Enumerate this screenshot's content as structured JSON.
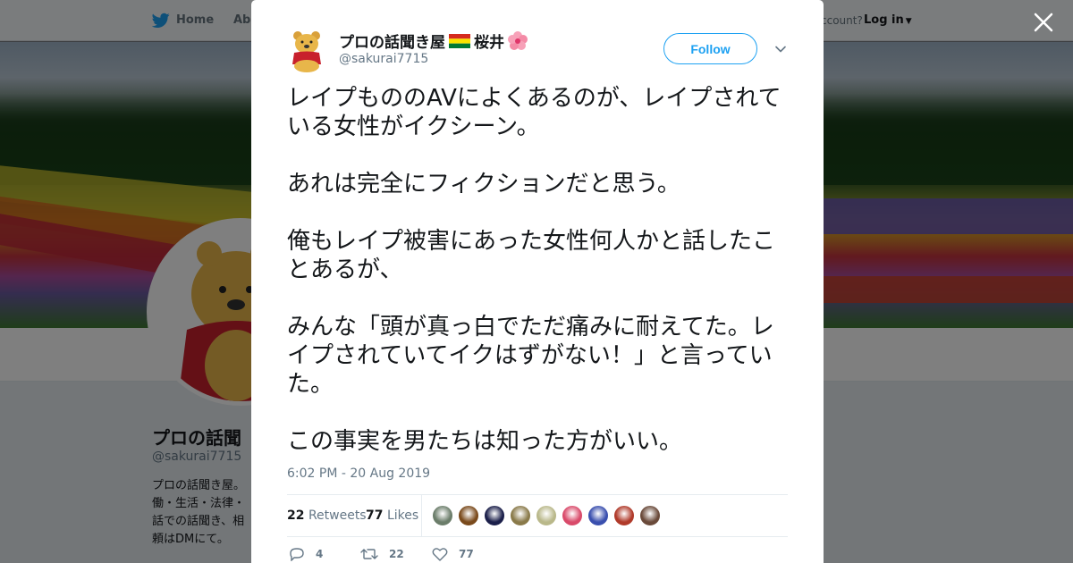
{
  "topnav": {
    "home_label": "Home",
    "about_label": "Abo",
    "account_prompt": "ccount?",
    "login_label": "Log in"
  },
  "profile": {
    "name": "プロの話聞",
    "handle": "@sakurai7715",
    "bio": "プロの話聞き屋。働・生活・法律・話での話聞き、相頼はDMにて。"
  },
  "tweet": {
    "author_name": "プロの話聞き屋",
    "author_suffix": "桜井",
    "author_handle": "@sakurai7715",
    "follow_label": "Follow",
    "paragraphs": [
      "レイプもののAVによくあるのが、レイプされている女性がイクシーン。",
      "あれは完全にフィクションだと思う。",
      "俺もレイプ被害にあった女性何人かと話したことあるが、",
      "みんな「頭が真っ白でただ痛みに耐えてた。レイプされていてイクはずがない！」と言っていた。",
      "この事実を男たちは知った方がいい。"
    ],
    "timestamp": "6:02 PM - 20 Aug 2019",
    "retweets_count": "22",
    "retweets_label": "Retweets",
    "likes_count": "77",
    "likes_label": "Likes",
    "reply_count": "4",
    "retweet_action_count": "22",
    "like_action_count": "77"
  },
  "liker_avatar_colors": [
    "#6b7d6a",
    "#7a4a1c",
    "#1b1f4a",
    "#8a7a4a",
    "#b9b88a",
    "#d94a6a",
    "#3a4fae",
    "#b03a2a",
    "#6a4a3a"
  ],
  "icons": {
    "brand": "twitter-bird-icon",
    "close": "close-icon",
    "menu": "chevron-down-icon",
    "reply": "reply-icon",
    "retweet": "retweet-icon",
    "like": "heart-icon"
  },
  "colors": {
    "accent": "#1da1f2",
    "text": "#14171a",
    "muted": "#657786"
  }
}
